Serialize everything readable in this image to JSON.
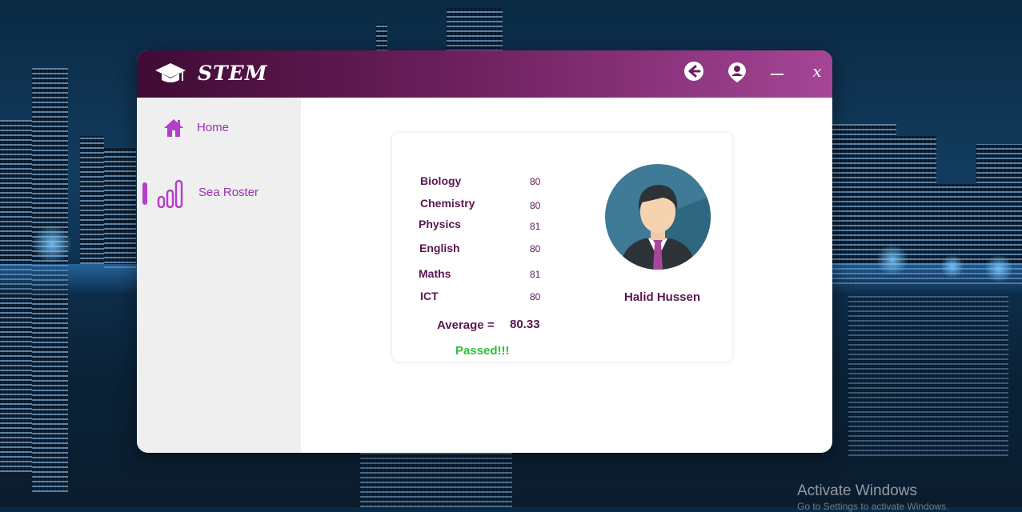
{
  "app": {
    "title": "STEM"
  },
  "titlebar": {
    "icons": [
      "graduation-cap-icon",
      "back-arrow-icon",
      "user-pin-icon",
      "minimize-icon",
      "close-icon"
    ],
    "close_label": "x"
  },
  "sidebar": {
    "items": [
      {
        "label": "Home",
        "icon": "home-icon"
      },
      {
        "label": "Sea Roster",
        "icon": "bar-chart-icon",
        "active": true
      }
    ]
  },
  "report": {
    "subjects": [
      {
        "name": "Biology",
        "score": "80"
      },
      {
        "name": "Chemistry",
        "score": "80"
      },
      {
        "name": "Physics",
        "score": "81"
      },
      {
        "name": "English",
        "score": "80"
      },
      {
        "name": "Maths",
        "score": "81"
      },
      {
        "name": "ICT",
        "score": "80"
      }
    ],
    "average_label": "Average  =",
    "average_value": "80.33",
    "status": "Passed!!!",
    "student_name": "Halid Hussen",
    "avatar_icon": "student-avatar"
  },
  "desktop": {
    "watermark": "Activate Windows",
    "watermark_sub": "Go to Settings to activate Windows."
  },
  "colors": {
    "titlebar_start": "#3f0b34",
    "titlebar_end": "#a54596",
    "accent": "#9a2fb5",
    "text": "#5a1750",
    "passed": "#2fbf3a"
  }
}
